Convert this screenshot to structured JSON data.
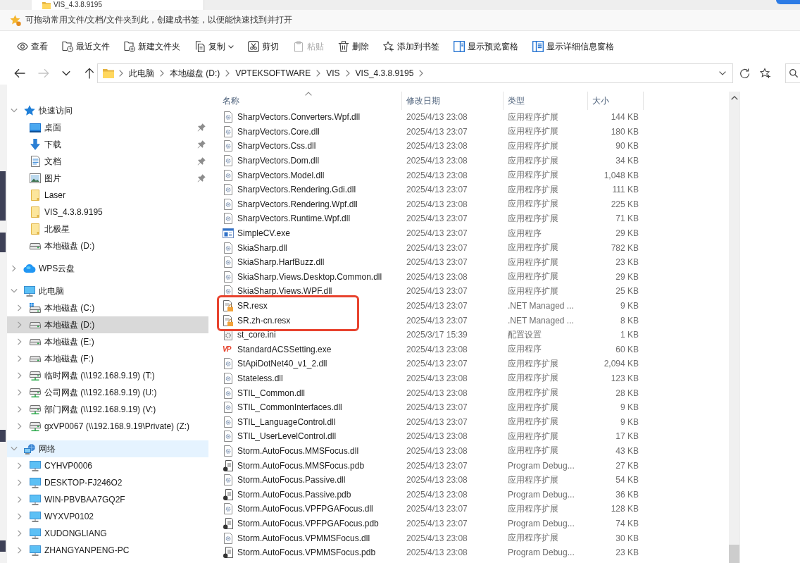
{
  "window_tab": {
    "title": "VIS_4.3.8.9195"
  },
  "bookmarks_bar": {
    "message": "可拖动常用文件/文档/文件夹到此，创建成书签，以便能快速找到并打开"
  },
  "toolbar": [
    {
      "label": "查看",
      "kind": "view",
      "disabled": false,
      "menu": false
    },
    {
      "label": "最近文件",
      "kind": "recent",
      "disabled": false,
      "menu": false
    },
    {
      "label": "新建文件夹",
      "kind": "new-folder",
      "disabled": false,
      "menu": false
    },
    {
      "label": "复制",
      "kind": "copy",
      "disabled": false,
      "menu": true
    },
    {
      "label": "剪切",
      "kind": "cut",
      "disabled": false,
      "menu": false
    },
    {
      "label": "粘贴",
      "kind": "paste",
      "disabled": true,
      "menu": false
    },
    {
      "label": "删除",
      "kind": "delete",
      "disabled": false,
      "menu": false
    },
    {
      "label": "添加到书签",
      "kind": "bookmark",
      "disabled": false,
      "menu": false
    },
    {
      "label": "显示预览窗格",
      "kind": "preview-pane",
      "disabled": false,
      "menu": false
    },
    {
      "label": "显示详细信息窗格",
      "kind": "details-pane",
      "disabled": false,
      "menu": false
    }
  ],
  "navigation": [
    {
      "kind": "back",
      "disabled": false
    },
    {
      "kind": "forward",
      "disabled": true
    },
    {
      "kind": "history",
      "disabled": false
    },
    {
      "kind": "up",
      "disabled": false
    }
  ],
  "address_bar": {
    "path": [
      "此电脑",
      "本地磁盘 (D:)",
      "VPTEKSOFTWARE",
      "VIS",
      "VIS_4.3.8.9195"
    ]
  },
  "sidebar": {
    "items": [
      {
        "label": "快速访问",
        "kind": "quick-access",
        "expanded": true,
        "selected": false,
        "hovered": false,
        "children": [
          {
            "label": "桌面",
            "kind": "desktop",
            "pinned": true,
            "selected": false
          },
          {
            "label": "下载",
            "kind": "downloads",
            "pinned": true,
            "selected": false
          },
          {
            "label": "文档",
            "kind": "documents",
            "pinned": true,
            "selected": false
          },
          {
            "label": "图片",
            "kind": "pictures",
            "pinned": true,
            "selected": false
          },
          {
            "label": "Laser",
            "kind": "folder",
            "pinned": false,
            "selected": false
          },
          {
            "label": "VIS_4.3.8.9195",
            "kind": "folder",
            "pinned": false,
            "selected": false
          },
          {
            "label": "北极星",
            "kind": "folder",
            "pinned": false,
            "selected": false
          },
          {
            "label": "本地磁盘 (D:)",
            "kind": "drive",
            "pinned": false,
            "selected": false
          }
        ]
      },
      {
        "label": "WPS云盘",
        "kind": "cloud",
        "expanded": false,
        "selected": false,
        "hovered": false
      },
      {
        "label": "此电脑",
        "kind": "this-pc",
        "expanded": true,
        "selected": false,
        "hovered": false,
        "children": [
          {
            "label": "本地磁盘 (C:)",
            "kind": "system-drive",
            "expanded": false,
            "selected": false
          },
          {
            "label": "本地磁盘 (D:)",
            "kind": "drive",
            "expanded": false,
            "selected": true
          },
          {
            "label": "本地磁盘 (E:)",
            "kind": "drive",
            "expanded": false,
            "selected": false
          },
          {
            "label": "本地磁盘 (F:)",
            "kind": "drive",
            "expanded": false,
            "selected": false
          },
          {
            "label": "临时网盘 (\\\\192.168.9.19) (T:)",
            "kind": "network-drive",
            "expanded": false,
            "selected": false
          },
          {
            "label": "公司网盘 (\\\\192.168.9.19) (U:)",
            "kind": "network-drive",
            "expanded": false,
            "selected": false
          },
          {
            "label": "部门网盘 (\\\\192.168.9.19) (V:)",
            "kind": "network-drive",
            "expanded": false,
            "selected": false
          },
          {
            "label": "gxVP0067 (\\\\192.168.9.19\\Private) (Z:)",
            "kind": "network-drive",
            "expanded": false,
            "selected": false
          }
        ]
      },
      {
        "label": "网络",
        "kind": "network",
        "expanded": true,
        "selected": false,
        "hovered": true,
        "children": [
          {
            "label": "CYHVP0006",
            "kind": "computer",
            "expanded": false,
            "selected": false
          },
          {
            "label": "DESKTOP-FJ246O2",
            "kind": "computer",
            "expanded": false,
            "selected": false
          },
          {
            "label": "WIN-PBVBAA7GQ2F",
            "kind": "computer",
            "expanded": false,
            "selected": false
          },
          {
            "label": "WYXVP0102",
            "kind": "computer",
            "expanded": false,
            "selected": false
          },
          {
            "label": "XUDONGLIANG",
            "kind": "computer",
            "expanded": false,
            "selected": false
          },
          {
            "label": "ZHANGYANPENG-PC",
            "kind": "computer",
            "expanded": false,
            "selected": false
          }
        ]
      }
    ]
  },
  "file_list": {
    "columns": [
      {
        "label": "名称",
        "sorted": true
      },
      {
        "label": "修改日期",
        "sorted": false
      },
      {
        "label": "类型",
        "sorted": false
      },
      {
        "label": "大小",
        "sorted": false
      }
    ],
    "rows": [
      {
        "name": "SharpVectors.Converters.Wpf.dll",
        "modified": "2025/4/13 23:08",
        "type": "应用程序扩展",
        "size": "144 KB",
        "kind": "dll",
        "marked": false
      },
      {
        "name": "SharpVectors.Core.dll",
        "modified": "2025/4/13 23:07",
        "type": "应用程序扩展",
        "size": "180 KB",
        "kind": "dll",
        "marked": false
      },
      {
        "name": "SharpVectors.Css.dll",
        "modified": "2025/4/13 23:08",
        "type": "应用程序扩展",
        "size": "90 KB",
        "kind": "dll",
        "marked": false
      },
      {
        "name": "SharpVectors.Dom.dll",
        "modified": "2025/4/13 23:08",
        "type": "应用程序扩展",
        "size": "34 KB",
        "kind": "dll",
        "marked": false
      },
      {
        "name": "SharpVectors.Model.dll",
        "modified": "2025/4/13 23:08",
        "type": "应用程序扩展",
        "size": "1,048 KB",
        "kind": "dll",
        "marked": false
      },
      {
        "name": "SharpVectors.Rendering.Gdi.dll",
        "modified": "2025/4/13 23:07",
        "type": "应用程序扩展",
        "size": "111 KB",
        "kind": "dll",
        "marked": false
      },
      {
        "name": "SharpVectors.Rendering.Wpf.dll",
        "modified": "2025/4/13 23:08",
        "type": "应用程序扩展",
        "size": "225 KB",
        "kind": "dll",
        "marked": false
      },
      {
        "name": "SharpVectors.Runtime.Wpf.dll",
        "modified": "2025/4/13 23:07",
        "type": "应用程序扩展",
        "size": "71 KB",
        "kind": "dll",
        "marked": false
      },
      {
        "name": "SimpleCV.exe",
        "modified": "2025/4/13 23:07",
        "type": "应用程序",
        "size": "29 KB",
        "kind": "exe",
        "marked": false
      },
      {
        "name": "SkiaSharp.dll",
        "modified": "2025/4/13 23:07",
        "type": "应用程序扩展",
        "size": "782 KB",
        "kind": "dll",
        "marked": false
      },
      {
        "name": "SkiaSharp.HarfBuzz.dll",
        "modified": "2025/4/13 23:07",
        "type": "应用程序扩展",
        "size": "23 KB",
        "kind": "dll",
        "marked": false
      },
      {
        "name": "SkiaSharp.Views.Desktop.Common.dll",
        "modified": "2025/4/13 23:08",
        "type": "应用程序扩展",
        "size": "29 KB",
        "kind": "dll",
        "marked": false
      },
      {
        "name": "SkiaSharp.Views.WPF.dll",
        "modified": "2025/4/13 23:07",
        "type": "应用程序扩展",
        "size": "25 KB",
        "kind": "dll",
        "marked": false
      },
      {
        "name": "SR.resx",
        "modified": "2025/4/13 23:07",
        "type": ".NET Managed ...",
        "size": "9 KB",
        "kind": "resx",
        "marked": true
      },
      {
        "name": "SR.zh-cn.resx",
        "modified": "2025/4/13 23:07",
        "type": ".NET Managed ...",
        "size": "8 KB",
        "kind": "resx",
        "marked": true
      },
      {
        "name": "st_core.ini",
        "modified": "2025/3/17 15:39",
        "type": "配置设置",
        "size": "1 KB",
        "kind": "ini",
        "marked": false
      },
      {
        "name": "StandardACSSetting.exe",
        "modified": "2025/4/13 23:08",
        "type": "应用程序",
        "size": "60 KB",
        "kind": "branded-exe",
        "logo": "VP",
        "marked": false
      },
      {
        "name": "StApiDotNet40_v1_2.dll",
        "modified": "2025/4/13 23:07",
        "type": "应用程序扩展",
        "size": "2,094 KB",
        "kind": "dll",
        "marked": false
      },
      {
        "name": "Stateless.dll",
        "modified": "2025/4/13 23:08",
        "type": "应用程序扩展",
        "size": "123 KB",
        "kind": "dll",
        "marked": false
      },
      {
        "name": "STIL_Common.dll",
        "modified": "2025/4/13 23:08",
        "type": "应用程序扩展",
        "size": "28 KB",
        "kind": "dll",
        "marked": false
      },
      {
        "name": "STIL_CommonInterfaces.dll",
        "modified": "2025/4/13 23:07",
        "type": "应用程序扩展",
        "size": "9 KB",
        "kind": "dll",
        "marked": false
      },
      {
        "name": "STIL_LanguageControl.dll",
        "modified": "2025/4/13 23:07",
        "type": "应用程序扩展",
        "size": "9 KB",
        "kind": "dll",
        "marked": false
      },
      {
        "name": "STIL_UserLevelControl.dll",
        "modified": "2025/4/13 23:08",
        "type": "应用程序扩展",
        "size": "17 KB",
        "kind": "dll",
        "marked": false
      },
      {
        "name": "Storm.AutoFocus.MMSFocus.dll",
        "modified": "2025/4/13 23:08",
        "type": "应用程序扩展",
        "size": "43 KB",
        "kind": "dll",
        "marked": false
      },
      {
        "name": "Storm.AutoFocus.MMSFocus.pdb",
        "modified": "2025/4/13 23:07",
        "type": "Program Debug...",
        "size": "27 KB",
        "kind": "pdb",
        "marked": false
      },
      {
        "name": "Storm.AutoFocus.Passive.dll",
        "modified": "2025/4/13 23:08",
        "type": "应用程序扩展",
        "size": "54 KB",
        "kind": "dll",
        "marked": false
      },
      {
        "name": "Storm.AutoFocus.Passive.pdb",
        "modified": "2025/4/13 23:08",
        "type": "Program Debug...",
        "size": "36 KB",
        "kind": "pdb",
        "marked": false
      },
      {
        "name": "Storm.AutoFocus.VPFPGAFocus.dll",
        "modified": "2025/4/13 23:07",
        "type": "应用程序扩展",
        "size": "128 KB",
        "kind": "dll",
        "marked": false
      },
      {
        "name": "Storm.AutoFocus.VPFPGAFocus.pdb",
        "modified": "2025/4/13 23:07",
        "type": "Program Debug...",
        "size": "74 KB",
        "kind": "pdb",
        "marked": false
      },
      {
        "name": "Storm.AutoFocus.VPMMSFocus.dll",
        "modified": "2025/4/13 23:08",
        "type": "应用程序扩展",
        "size": "30 KB",
        "kind": "dll",
        "marked": false
      },
      {
        "name": "Storm.AutoFocus.VPMMSFocus.pdb",
        "modified": "2025/4/13 23:08",
        "type": "Program Debug...",
        "size": "23 KB",
        "kind": "pdb",
        "marked": false
      }
    ]
  }
}
